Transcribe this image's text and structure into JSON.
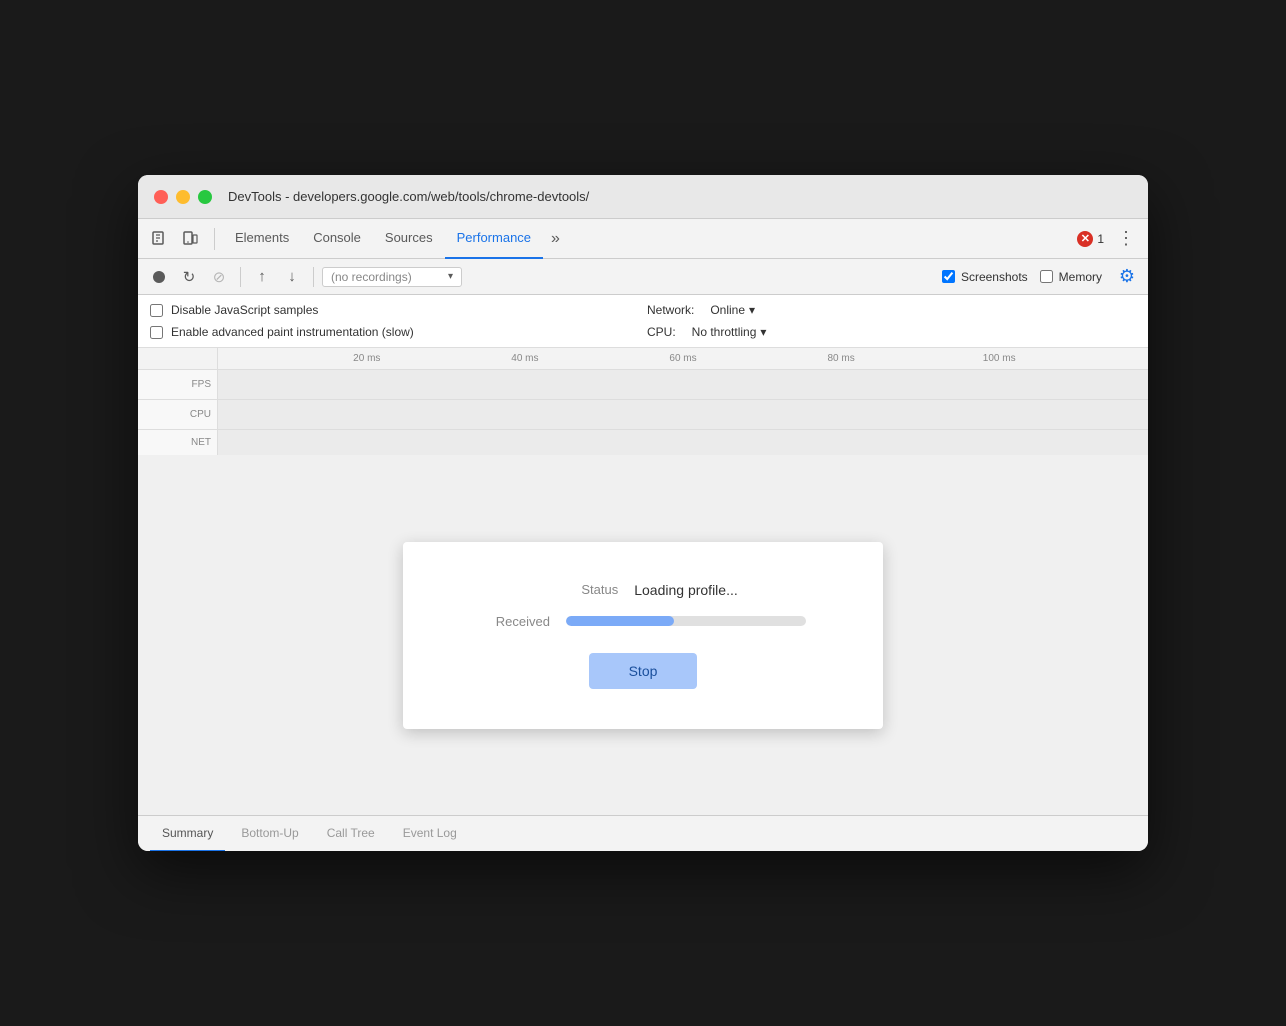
{
  "window": {
    "title": "DevTools - developers.google.com/web/tools/chrome-devtools/"
  },
  "tabs": {
    "items": [
      {
        "label": "Elements",
        "active": false
      },
      {
        "label": "Console",
        "active": false
      },
      {
        "label": "Sources",
        "active": false
      },
      {
        "label": "Performance",
        "active": true
      }
    ],
    "more_label": "»",
    "error_count": "1"
  },
  "toolbar": {
    "recording_placeholder": "(no recordings)",
    "screenshots_label": "Screenshots",
    "memory_label": "Memory"
  },
  "settings": {
    "disable_js_samples": "Disable JavaScript samples",
    "enable_paint": "Enable advanced paint instrumentation (slow)",
    "network_label": "Network:",
    "network_value": "Online",
    "cpu_label": "CPU:",
    "cpu_value": "No throttling"
  },
  "timeline": {
    "ticks": [
      "20 ms",
      "40 ms",
      "60 ms",
      "80 ms",
      "100 ms"
    ],
    "fps_label": "FPS",
    "cpu_label": "CPU",
    "net_label": "NET"
  },
  "loading_dialog": {
    "status_label": "Status",
    "status_value": "Loading profile...",
    "received_label": "Received",
    "progress_percent": 45,
    "stop_label": "Stop"
  },
  "bottom_tabs": {
    "items": [
      {
        "label": "Summary",
        "active": true
      },
      {
        "label": "Bottom-Up",
        "active": false
      },
      {
        "label": "Call Tree",
        "active": false
      },
      {
        "label": "Event Log",
        "active": false
      }
    ]
  }
}
